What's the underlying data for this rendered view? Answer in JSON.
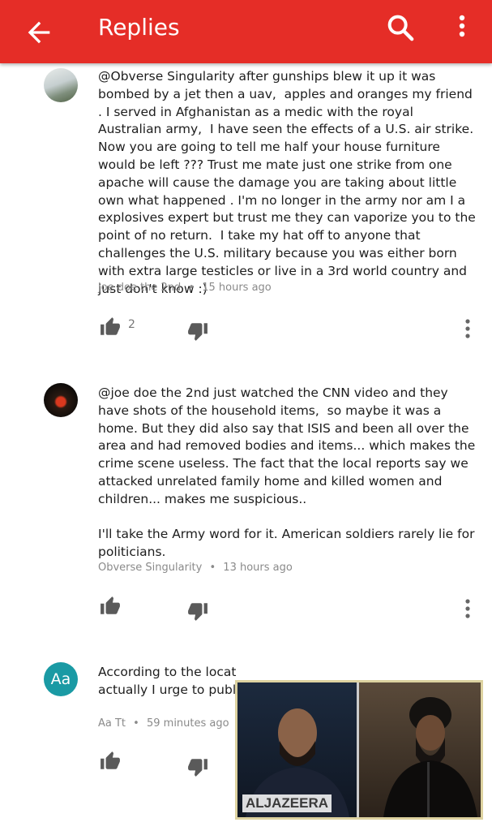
{
  "header": {
    "title": "Replies",
    "back_icon": "arrow-back-icon",
    "search_icon": "search-icon",
    "more_icon": "more-vert-icon",
    "bar_color": "#e52d27"
  },
  "comments": [
    {
      "avatar_label": "",
      "text": "@Obverse Singularity after gunships blew it up it was bombed by a jet then a uav,  apples and oranges my friend . I served in Afghanistan as a medic with the royal Australian army,  I have seen the effects of a U.S. air strike.  Now you are going to tell me half your house furniture would be left ??? Trust me mate just one strike from one apache will cause the damage you are taking about little own what happened . I'm no longer in the army nor am I a explosives expert but trust me they can vaporize you to the point of no return.  I take my hat off to anyone that challenges the U.S. military because you was either born with extra large testicles or live in a 3rd world country and just don't know :)",
      "author": "joe doe the 2nd",
      "time": "15 hours ago",
      "likes": "2"
    },
    {
      "avatar_label": "",
      "text": "@joe doe the 2nd just watched the CNN video and they have shots of the household items,  so maybe it was a home. But they did also say that ISIS and been all over the area and had removed bodies and items... which makes the crime scene useless. The fact that the local reports say we attacked unrelated family home and killed women and children... makes me suspicious..\n\nI'll take the Army word for it. American soldiers rarely lie for politicians.",
      "author": "Obverse Singularity",
      "time": "13 hours ago",
      "likes": ""
    },
    {
      "avatar_label": "Aa",
      "text": "According to the location he was hiding in territory under Russian sight in norther\nactually I urge to public",
      "author": "Aa Tt",
      "time": "59 minutes ago",
      "likes": ""
    }
  ],
  "video_overlay": {
    "logo_text": "ALJAZEERA",
    "border_color": "#ddd2a0"
  },
  "meta_separator": "•"
}
